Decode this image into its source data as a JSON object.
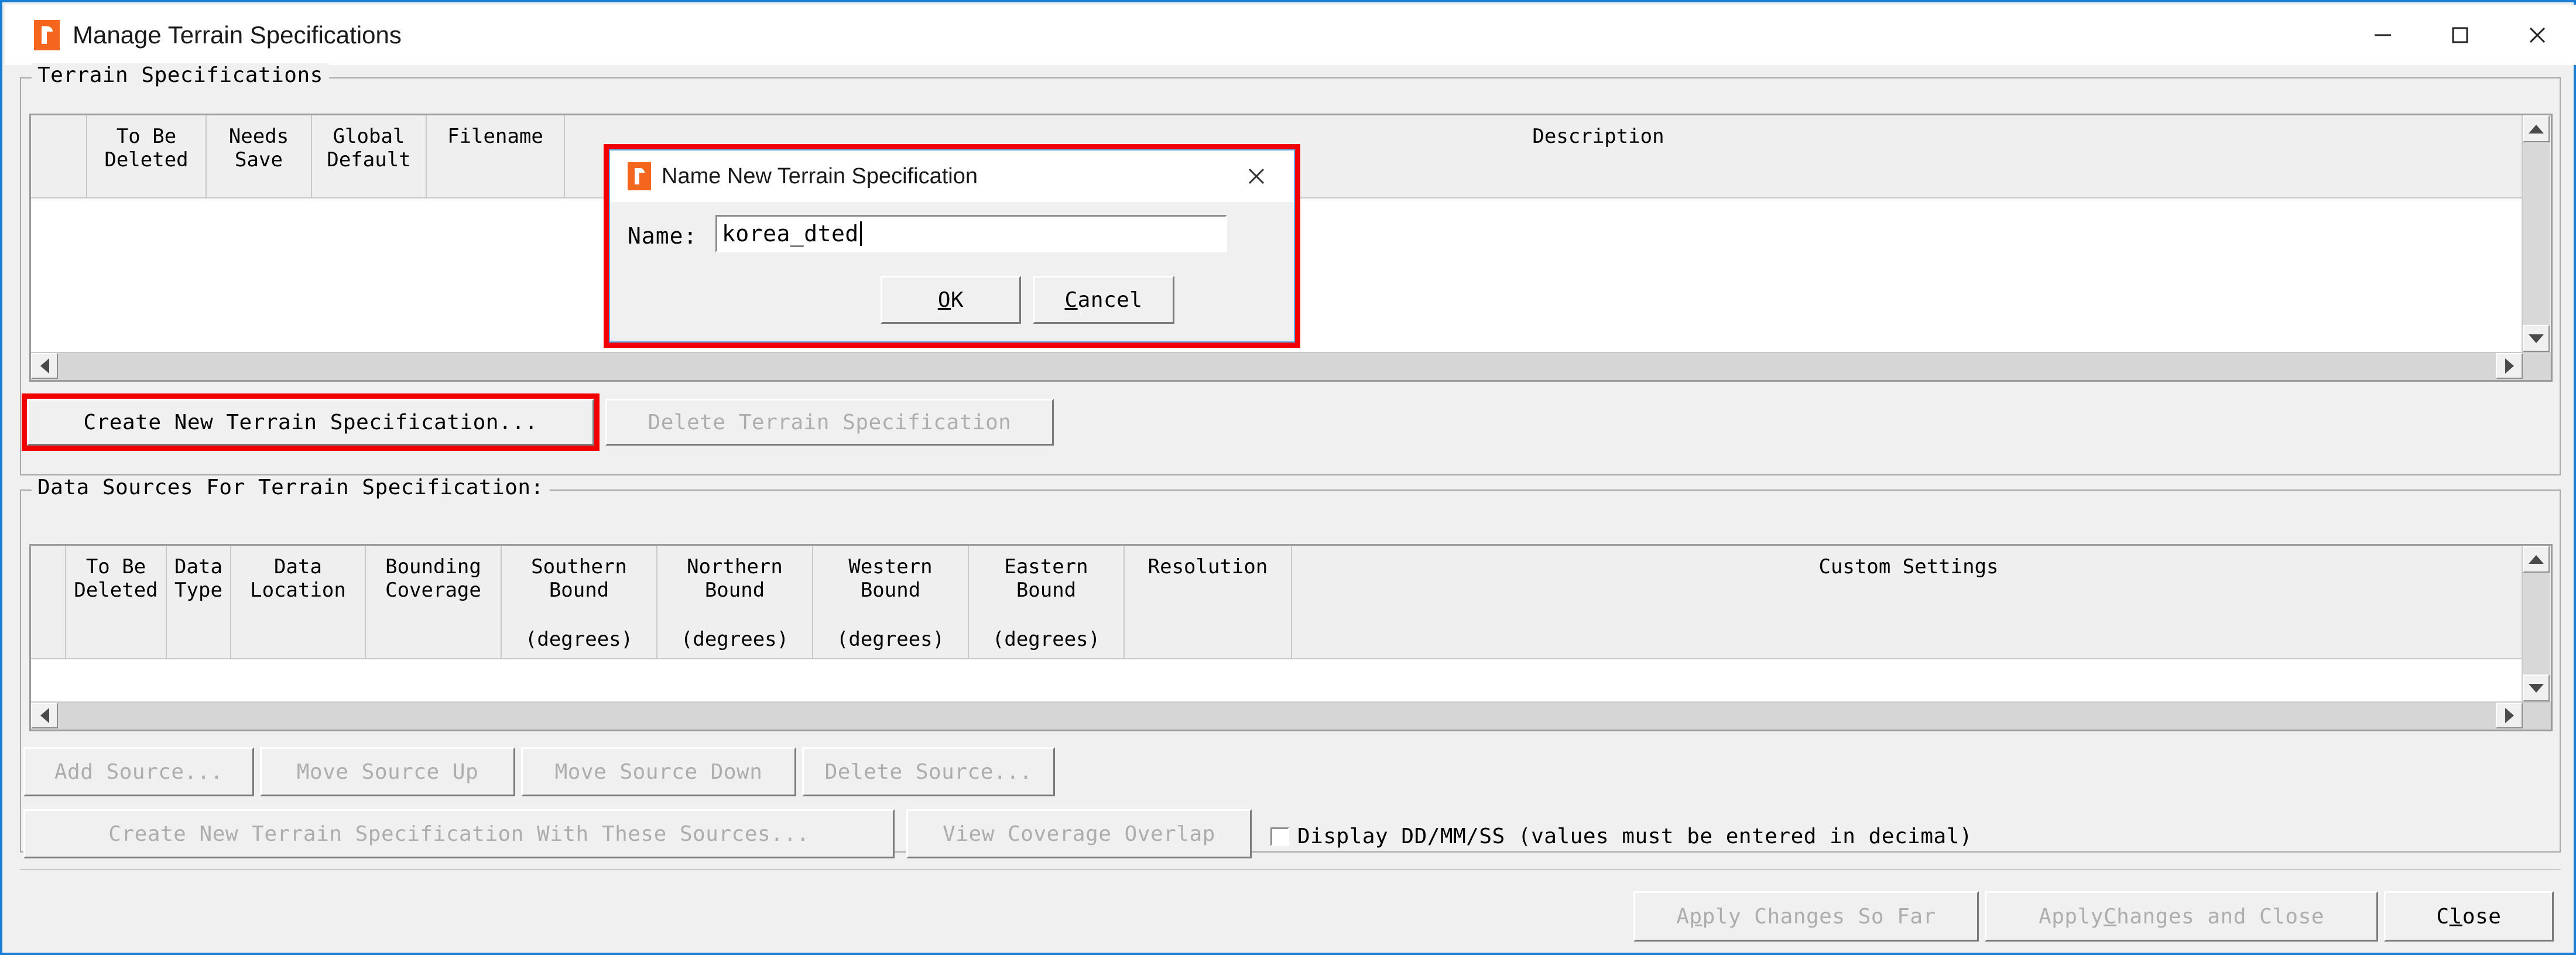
{
  "window": {
    "title": "Manage Terrain Specifications",
    "icon": "app-r-icon",
    "controls": {
      "minimize": "minimize-icon",
      "maximize": "maximize-icon",
      "close": "close-icon"
    },
    "border_color": "#1a7fd4"
  },
  "terrain_group": {
    "title": "Terrain Specifications",
    "table": {
      "columns": [
        "To Be\nDeleted",
        "Needs\nSave",
        "Global\nDefault",
        "Filename",
        "",
        "Description"
      ],
      "col_to_be_deleted": "To Be",
      "col_to_be_deleted2": "Deleted",
      "col_needs_save": "Needs",
      "col_needs_save2": "Save",
      "col_global_default": "Global",
      "col_global_default2": "Default",
      "col_filename": "Filename",
      "col_description": "Description",
      "rows": []
    },
    "create_button": "Create New Terrain Specification...",
    "create_button_highlight": "#f20000",
    "delete_button": "Delete Terrain Specification",
    "delete_button_enabled": false
  },
  "data_sources_group": {
    "title": "Data Sources For Terrain Specification:",
    "table": {
      "col_to_be_deleted": "To Be",
      "col_to_be_deleted2": "Deleted",
      "col_data_type": "Data",
      "col_data_type2": "Type",
      "col_data_location": "Data",
      "col_data_location2": "Location",
      "col_bounding_coverage": "Bounding",
      "col_bounding_coverage2": "Coverage",
      "col_southern_bound": "Southern",
      "col_southern_bound2": "Bound",
      "col_southern_bound3": "(degrees)",
      "col_northern_bound": "Northern",
      "col_northern_bound2": "Bound",
      "col_northern_bound3": "(degrees)",
      "col_western_bound": "Western",
      "col_western_bound2": "Bound",
      "col_western_bound3": "(degrees)",
      "col_eastern_bound": "Eastern",
      "col_eastern_bound2": "Bound",
      "col_eastern_bound3": "(degrees)",
      "col_resolution": "Resolution",
      "col_custom_settings": "Custom Settings",
      "rows": []
    },
    "buttons": [
      {
        "label": "Add Source...",
        "enabled": false
      },
      {
        "label": "Move Source Up",
        "enabled": false
      },
      {
        "label": "Move Source Down",
        "enabled": false
      },
      {
        "label": "Delete Source...",
        "enabled": false
      }
    ],
    "create_with_sources_button": "Create New Terrain Specification With These Sources...",
    "create_with_sources_enabled": false,
    "view_coverage_button": "View Coverage Overlap",
    "view_coverage_enabled": false,
    "ddmmss_checkbox": {
      "label": "Display DD/MM/SS (values must be entered in decimal)",
      "checked": false
    }
  },
  "footer": {
    "apply_so_far": {
      "pre": "A",
      "accel": "p",
      "post": "ply Changes So Far",
      "enabled": false
    },
    "apply_and_close": {
      "pre": "Apply ",
      "accel": "C",
      "post": "hanges and Close",
      "enabled": false
    },
    "close": {
      "pre": "C",
      "accel": "l",
      "post": "ose",
      "enabled": true
    }
  },
  "modal": {
    "title": "Name New Terrain Specification",
    "icon": "app-r-icon",
    "close_icon": "close-icon",
    "name_label": "Name:",
    "name_value": "korea_dted",
    "ok_button": {
      "accel": "O",
      "rest": "K"
    },
    "cancel_button": {
      "accel": "C",
      "rest": "ancel"
    },
    "highlight_color": "#f20000"
  }
}
